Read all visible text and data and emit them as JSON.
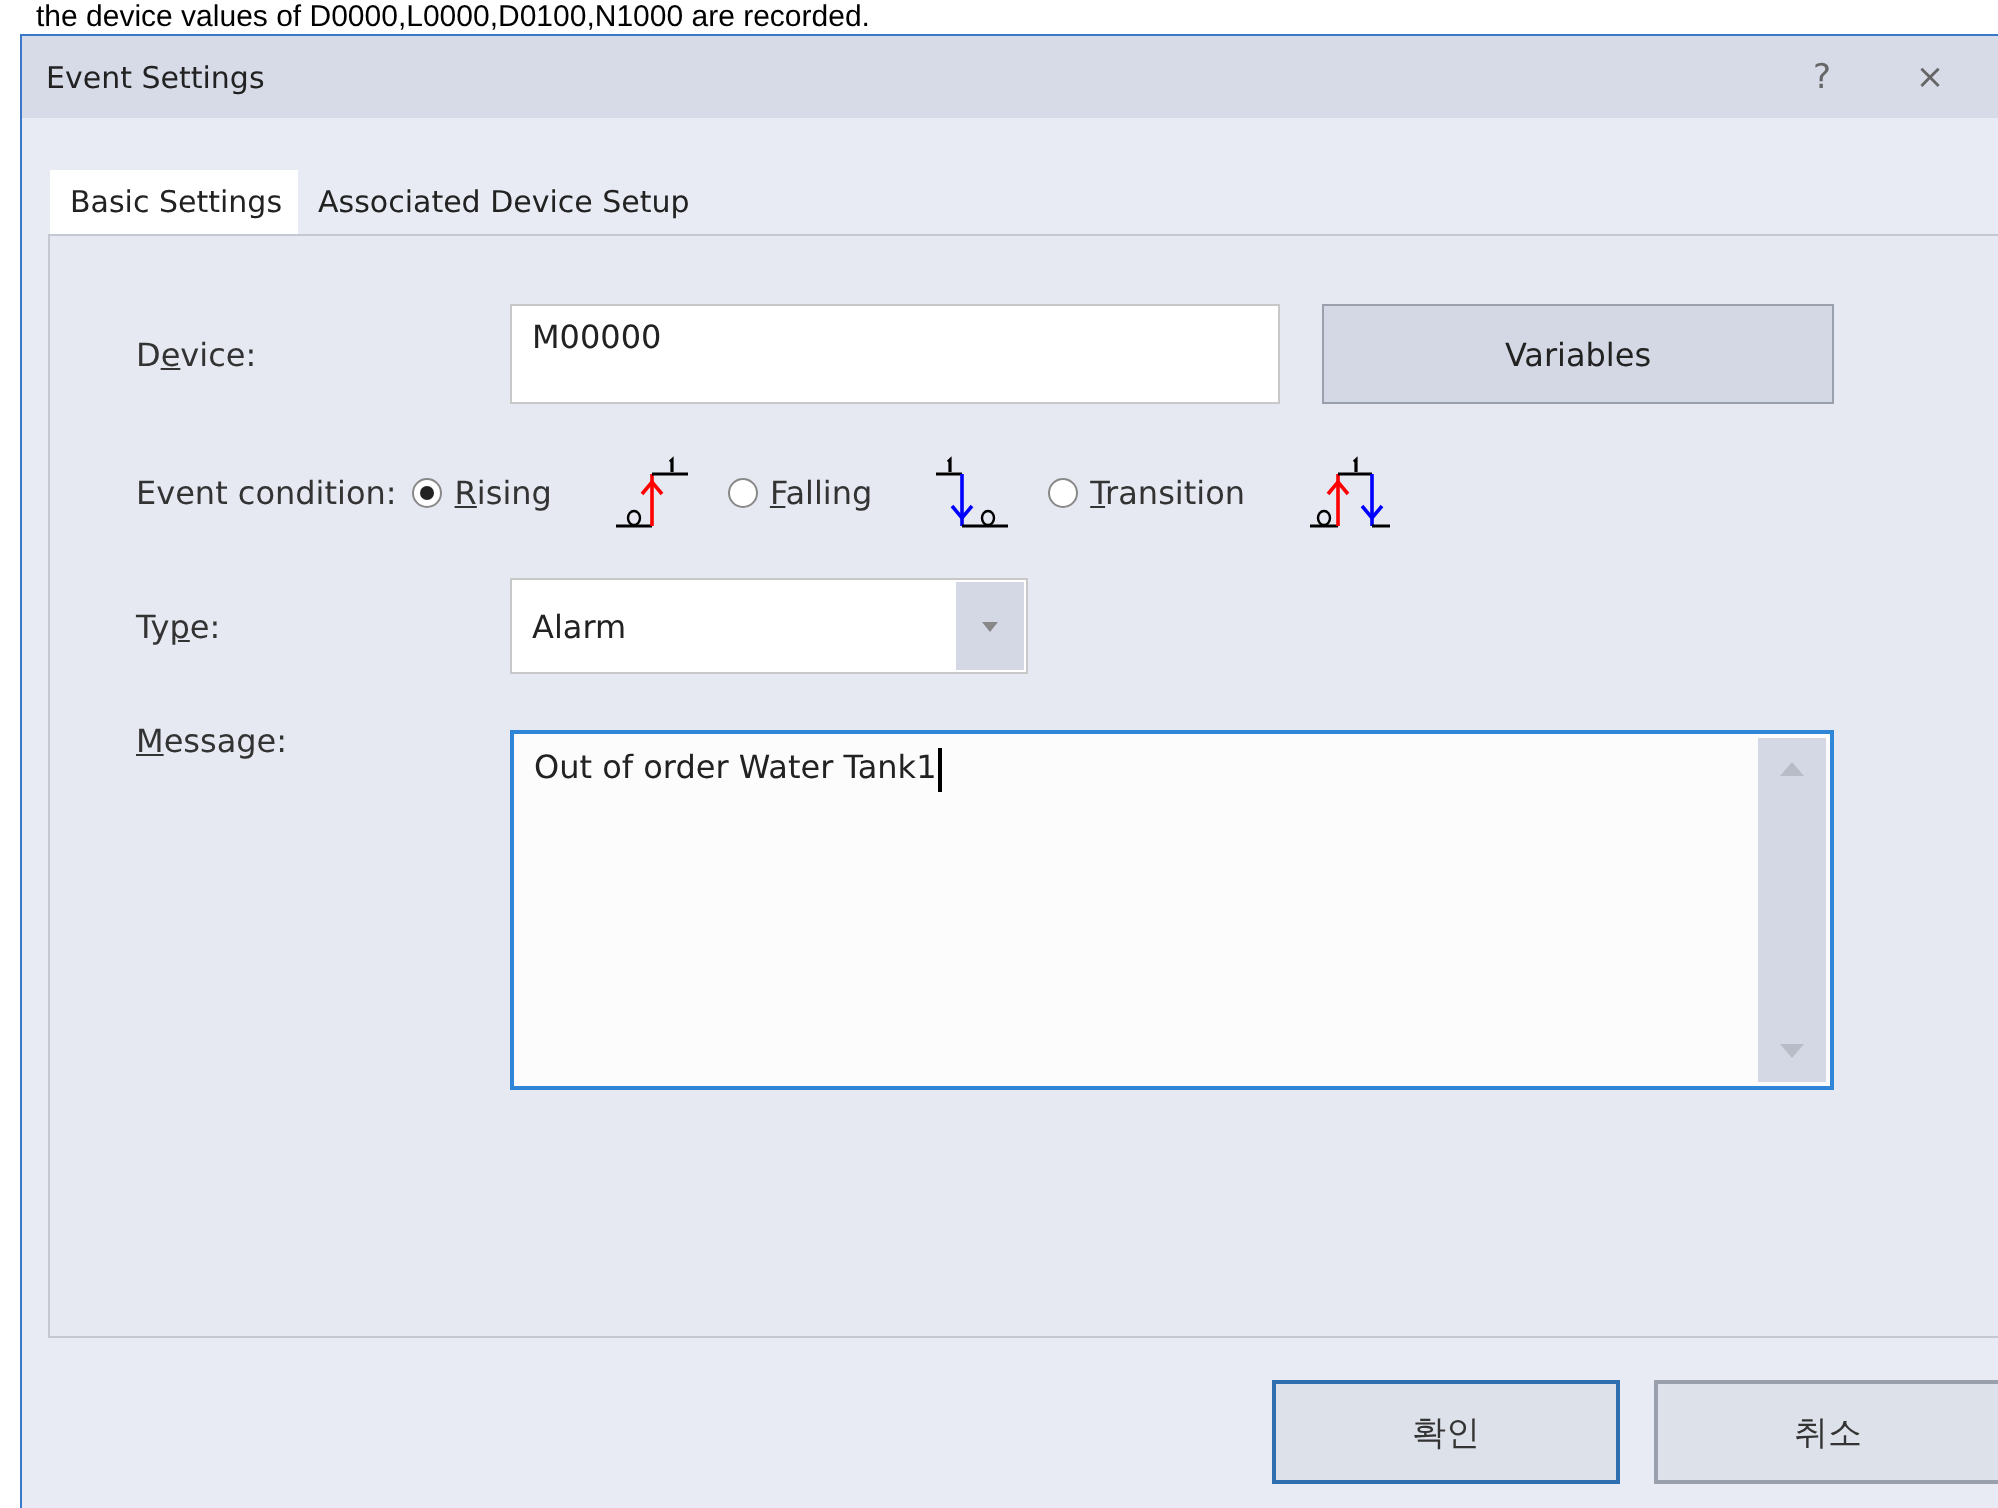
{
  "caption": "the device values of D0000,L0000,D0100,N1000 are recorded.",
  "window": {
    "title": "Event Settings",
    "help": "?",
    "close": "×"
  },
  "tabs": [
    {
      "label": "Basic Settings",
      "selected": true
    },
    {
      "label": "Associated Device Setup",
      "selected": false
    }
  ],
  "device": {
    "label_parts": {
      "before": "D",
      "key": "e",
      "after": "vice:"
    },
    "value": "M00000",
    "button": "Variables"
  },
  "event_condition": {
    "label": "Event condition:",
    "options": [
      {
        "kind": "rising",
        "label_parts": {
          "key": "R",
          "after": "ising"
        },
        "selected": true
      },
      {
        "kind": "falling",
        "label_parts": {
          "key": "F",
          "after": "alling"
        },
        "selected": false
      },
      {
        "kind": "transition",
        "label_parts": {
          "key": "T",
          "after": "ransition"
        },
        "selected": false
      }
    ]
  },
  "type": {
    "label_parts": {
      "before": "Ty",
      "key": "p",
      "after": "e:"
    },
    "value": "Alarm"
  },
  "message": {
    "label_parts": {
      "key": "M",
      "after": "essage:"
    },
    "value": "Out of order Water Tank1"
  },
  "buttons": [
    {
      "label": "확인",
      "default": true
    },
    {
      "label": "취소",
      "default": false
    }
  ]
}
